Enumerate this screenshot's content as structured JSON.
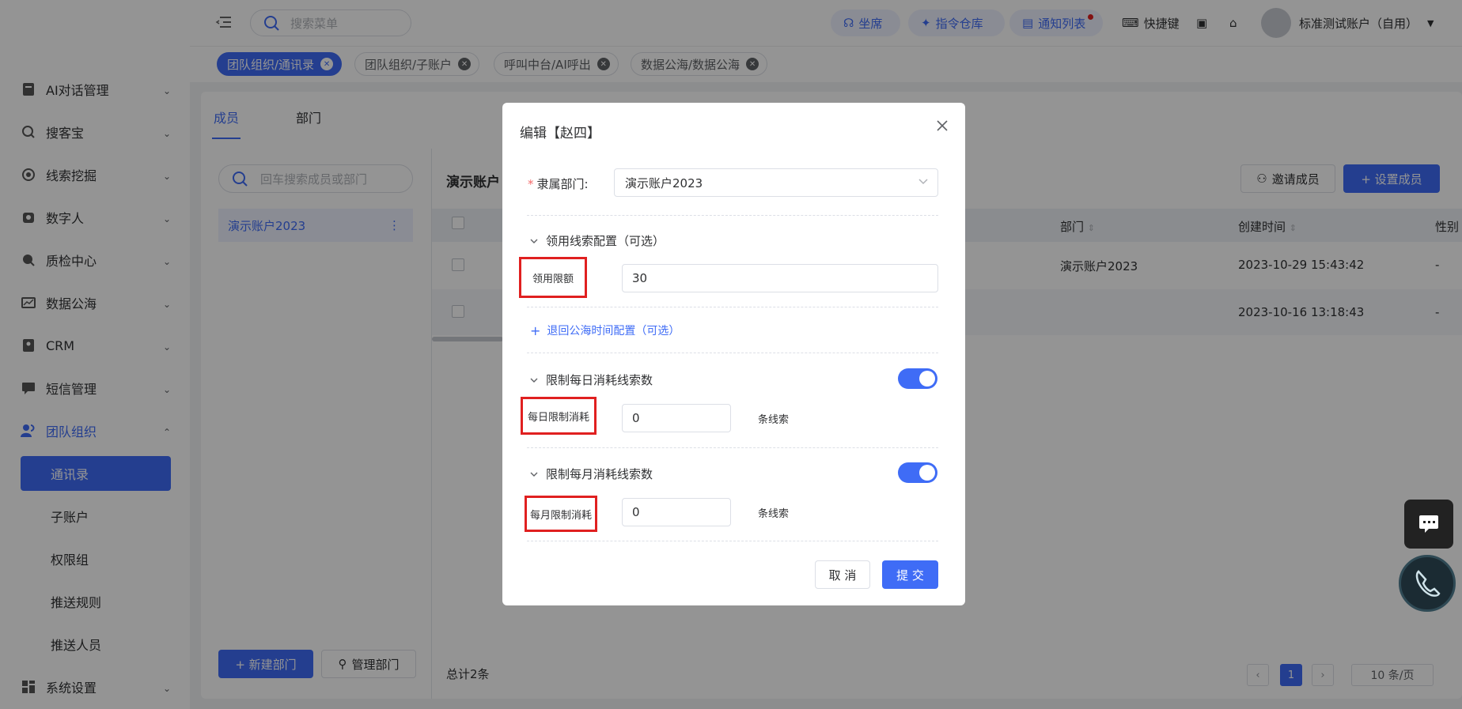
{
  "topbar": {
    "search_placeholder": "搜索菜单",
    "agent_pill": "坐席",
    "command_pill": "指令仓库",
    "notice_pill": "通知列表",
    "shortcut": "快捷键",
    "account": "标准测试账户（自用）"
  },
  "tags": [
    {
      "label": "团队组织/通讯录"
    },
    {
      "label": "团队组织/子账户"
    },
    {
      "label": "呼叫中台/AI呼出"
    },
    {
      "label": "数据公海/数据公海"
    }
  ],
  "sidebar": {
    "items": [
      {
        "label": "AI对话管理",
        "icon": "ai-dialog-icon"
      },
      {
        "label": "搜客宝",
        "icon": "search-customer-icon"
      },
      {
        "label": "线索挖掘",
        "icon": "lead-mining-icon"
      },
      {
        "label": "数字人",
        "icon": "digital-human-icon"
      },
      {
        "label": "质检中心",
        "icon": "quality-icon"
      },
      {
        "label": "数据公海",
        "icon": "data-sea-icon"
      },
      {
        "label": "CRM",
        "icon": "crm-icon"
      },
      {
        "label": "短信管理",
        "icon": "sms-icon"
      },
      {
        "label": "团队组织",
        "icon": "team-icon"
      },
      {
        "label": "系统设置",
        "icon": "settings-icon"
      }
    ],
    "sub_items": [
      {
        "label": "通讯录"
      },
      {
        "label": "子账户"
      },
      {
        "label": "权限组"
      },
      {
        "label": "推送规则"
      },
      {
        "label": "推送人员"
      }
    ]
  },
  "content": {
    "tabs": [
      "成员",
      "部门"
    ],
    "tree_search_placeholder": "回车搜索成员或部门",
    "tree_node": "演示账户2023",
    "panel_title": "演示账户",
    "new_dept": "+ 新建部门",
    "manage_dept": "管理部门",
    "invite": "邀请成员",
    "set_member": "+ 设置成员",
    "columns": {
      "dept": "部门",
      "created": "创建时间",
      "gender": "性别"
    },
    "rows": [
      {
        "dept": "演示账户2023",
        "created": "2023-10-29 15:43:42",
        "gender": "-"
      },
      {
        "dept": "",
        "created": "2023-10-16 13:18:43",
        "gender": "-"
      }
    ],
    "total": "总计2条",
    "page": "1",
    "page_size": "10 条/页"
  },
  "modal": {
    "title": "编辑【赵四】",
    "dept_label": "隶属部门:",
    "dept_value": "演示账户2023",
    "section1": "领用线索配置（可选）",
    "quota_label": "领用限额",
    "quota_value": "30",
    "return_link": "退回公海时间配置（可选）",
    "section2": "限制每日消耗线索数",
    "daily_label": "每日限制消耗",
    "daily_value": "0",
    "section3": "限制每月消耗线索数",
    "monthly_label": "每月限制消耗",
    "monthly_value": "0",
    "unit": "条线索",
    "cancel": "取 消",
    "submit": "提 交"
  },
  "colors": {
    "accent": "#3f6cf6",
    "highlight": "#e02020"
  }
}
